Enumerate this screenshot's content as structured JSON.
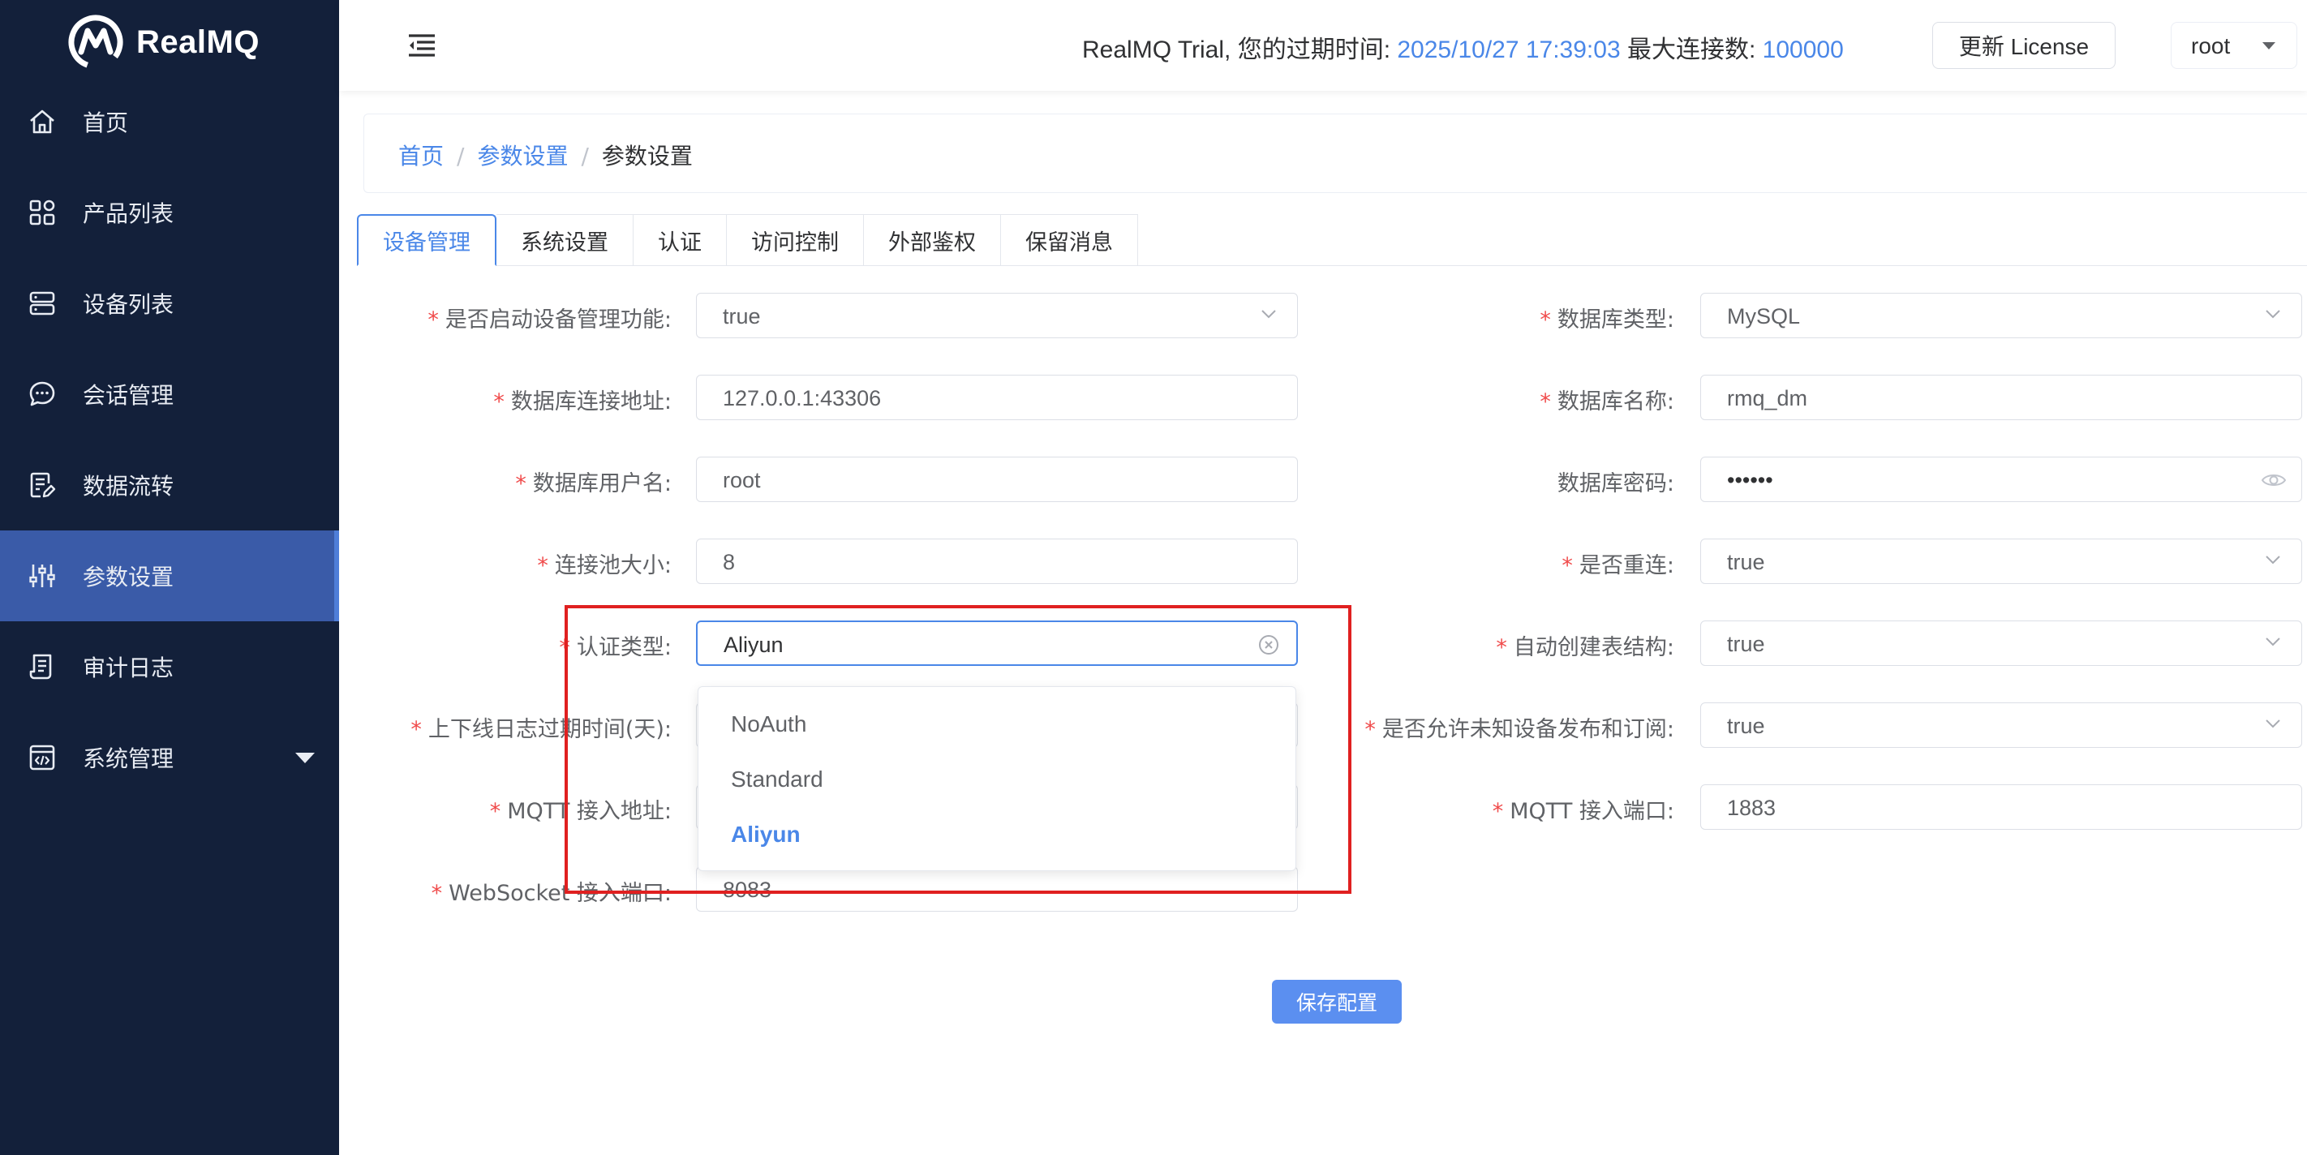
{
  "app": {
    "name": "RealMQ"
  },
  "sidebar": {
    "items": [
      {
        "label": "首页",
        "icon": "home-icon",
        "active": false
      },
      {
        "label": "产品列表",
        "icon": "grid-icon",
        "active": false
      },
      {
        "label": "设备列表",
        "icon": "server-icon",
        "active": false
      },
      {
        "label": "会话管理",
        "icon": "chat-icon",
        "active": false
      },
      {
        "label": "数据流转",
        "icon": "document-edit-icon",
        "active": false
      },
      {
        "label": "参数设置",
        "icon": "sliders-icon",
        "active": true
      },
      {
        "label": "审计日志",
        "icon": "log-icon",
        "active": false
      },
      {
        "label": "系统管理",
        "icon": "code-window-icon",
        "active": false,
        "expandable": true
      }
    ]
  },
  "header": {
    "trial_prefix": "RealMQ Trial, 您的过期时间: ",
    "expire_time": "2025/10/27 17:39:03",
    "max_conn_label": " 最大连接数: ",
    "max_conn_value": "100000",
    "license_button": "更新 License",
    "user": "root"
  },
  "breadcrumb": {
    "home": "首页",
    "parent": "参数设置",
    "current": "参数设置",
    "separator": "/"
  },
  "tabs": [
    {
      "label": "设备管理",
      "active": true
    },
    {
      "label": "系统设置",
      "active": false
    },
    {
      "label": "认证",
      "active": false
    },
    {
      "label": "访问控制",
      "active": false
    },
    {
      "label": "外部鉴权",
      "active": false
    },
    {
      "label": "保留消息",
      "active": false
    }
  ],
  "form": {
    "left": [
      {
        "label": "是否启动设备管理功能:",
        "required": true,
        "value": "true",
        "type": "select"
      },
      {
        "label": "数据库连接地址:",
        "required": true,
        "value": "127.0.0.1:43306",
        "type": "input"
      },
      {
        "label": "数据库用户名:",
        "required": true,
        "value": "root",
        "type": "input"
      },
      {
        "label": "连接池大小:",
        "required": true,
        "value": "8",
        "type": "input"
      },
      {
        "label": "认证类型:",
        "required": true,
        "value": "Aliyun",
        "type": "select-open"
      },
      {
        "label": "上下线日志过期时间(天):",
        "required": true,
        "value": "",
        "type": "input"
      },
      {
        "label": "MQTT 接入地址:",
        "required": true,
        "value": "",
        "type": "input"
      },
      {
        "label": "WebSocket 接入端口:",
        "required": true,
        "value": "8083",
        "type": "input"
      }
    ],
    "right": [
      {
        "label": "数据库类型:",
        "required": true,
        "value": "MySQL",
        "type": "select"
      },
      {
        "label": "数据库名称:",
        "required": true,
        "value": "rmq_dm",
        "type": "input"
      },
      {
        "label": "数据库密码:",
        "required": false,
        "value": "••••••",
        "type": "password"
      },
      {
        "label": "是否重连:",
        "required": true,
        "value": "true",
        "type": "select"
      },
      {
        "label": "自动创建表结构:",
        "required": true,
        "value": "true",
        "type": "select"
      },
      {
        "label": "是否允许未知设备发布和订阅:",
        "required": true,
        "value": "true",
        "type": "select"
      },
      {
        "label": "MQTT 接入端口:",
        "required": true,
        "value": "1883",
        "type": "input"
      }
    ],
    "required_mark": "*"
  },
  "auth_dropdown": {
    "options": [
      "NoAuth",
      "Standard",
      "Aliyun"
    ],
    "selected": "Aliyun"
  },
  "save_button": "保存配置",
  "colors": {
    "sidebar_bg": "#13203a",
    "sidebar_active": "#3a5ba8",
    "accent": "#4a87e8",
    "required": "#f04b4b",
    "highlight_box": "#e02020"
  }
}
